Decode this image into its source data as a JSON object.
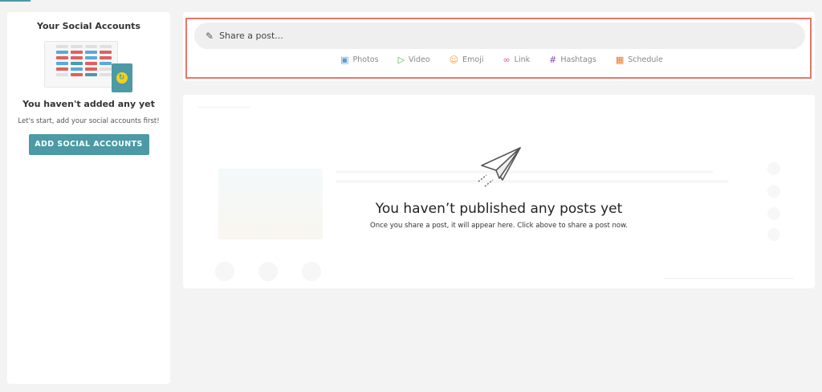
{
  "left_panel": {
    "title": "Your Social Accounts",
    "subtitle": "You haven't added any yet",
    "description": "Let's start, add your social accounts first!",
    "add_button": "ADD SOCIAL ACCOUNTS"
  },
  "share": {
    "placeholder": "Share a post...",
    "actions": [
      {
        "label": "Photos",
        "icon": "image-icon",
        "color": "#5b9bd5"
      },
      {
        "label": "Video",
        "icon": "play-icon",
        "color": "#4caf50"
      },
      {
        "label": "Emoji",
        "icon": "smiley-icon",
        "color": "#f0a030"
      },
      {
        "label": "Link",
        "icon": "link-icon",
        "color": "#e05a7a"
      },
      {
        "label": "Hashtags",
        "icon": "hashtag-icon",
        "color": "#8a4fb0"
      },
      {
        "label": "Schedule",
        "icon": "calendar-icon",
        "color": "#e8762d"
      }
    ]
  },
  "posts": {
    "empty_title": "You haven’t published any posts yet",
    "empty_description": "Once you share a post, it will appear here. Click above to share a post now."
  },
  "colors": {
    "accent": "#4b9aa6",
    "highlight_border": "#e8766a"
  }
}
